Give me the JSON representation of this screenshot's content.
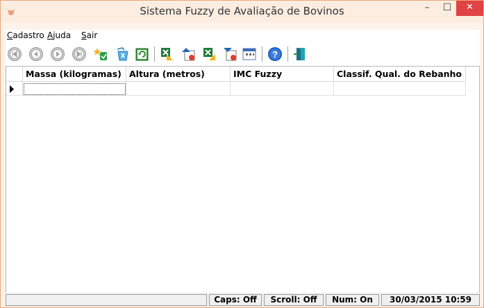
{
  "window": {
    "title": "Sistema Fuzzy de Avaliação de Bovinos"
  },
  "menu": [
    {
      "key": "C",
      "rest": "adastro"
    },
    {
      "key": "A",
      "rest": "juda"
    },
    {
      "key": "S",
      "rest": "air"
    }
  ],
  "toolbar": {
    "buttons": [
      "first-record-icon",
      "previous-record-icon",
      "next-record-icon",
      "last-record-icon",
      "new-record-icon",
      "delete-record-icon",
      "refresh-icon",
      "import-excel-icon",
      "export-data-icon",
      "export-excel-icon",
      "import-data-icon",
      "calendar-icon",
      "help-icon",
      "exit-door-icon"
    ]
  },
  "grid": {
    "columns": [
      "Massa (kilogramas)",
      "Altura (metros)",
      "IMC Fuzzy",
      "Classif. Qual. do Rebanho"
    ],
    "rows": [
      [
        "",
        "",
        "",
        ""
      ]
    ]
  },
  "status": {
    "caps": "Caps: Off",
    "scroll": "Scroll: Off",
    "num": "Num: On",
    "datetime": "30/03/2015 10:59"
  },
  "colors": {
    "accent": "#e04343",
    "frame": "#e8a77a",
    "titlebar": "#fcede0"
  }
}
